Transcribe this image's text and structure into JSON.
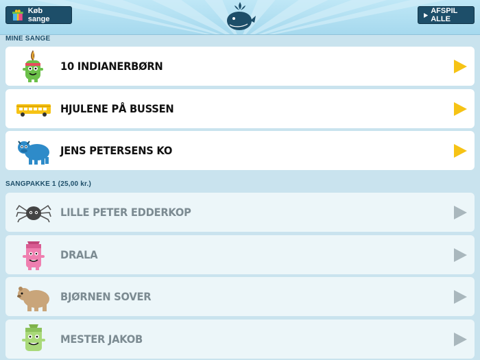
{
  "header": {
    "buy_label": "Køb sange",
    "play_all_label": "AFSPIL ALLE",
    "logo_icon": "whale-icon",
    "gift_icon": "gift-box-icon"
  },
  "sections": {
    "my_songs": "MINE SANGE",
    "pack1": "SANGPAKKE 1 (25,00 kr.)"
  },
  "songs": [
    {
      "title": "10 INDIANERBØRN",
      "icon": "green-monster-feather-icon",
      "owned": true
    },
    {
      "title": "HJULENE PÅ BUSSEN",
      "icon": "yellow-bus-icon",
      "owned": true
    },
    {
      "title": "JENS PETERSENS KO",
      "icon": "blue-cow-icon",
      "owned": true
    },
    {
      "title": "LILLE PETER EDDERKOP",
      "icon": "spider-icon",
      "owned": false
    },
    {
      "title": "DRALA",
      "icon": "pink-monster-icon",
      "owned": false
    },
    {
      "title": "BJØRNEN SOVER",
      "icon": "bear-icon",
      "owned": false
    },
    {
      "title": "MESTER JAKOB",
      "icon": "green-monster-icon",
      "owned": false
    }
  ],
  "colors": {
    "owned_play": "#f6c315",
    "locked_play": "#a9b7bd",
    "header_button": "#1d4e69",
    "background": "#c9e3ee"
  }
}
